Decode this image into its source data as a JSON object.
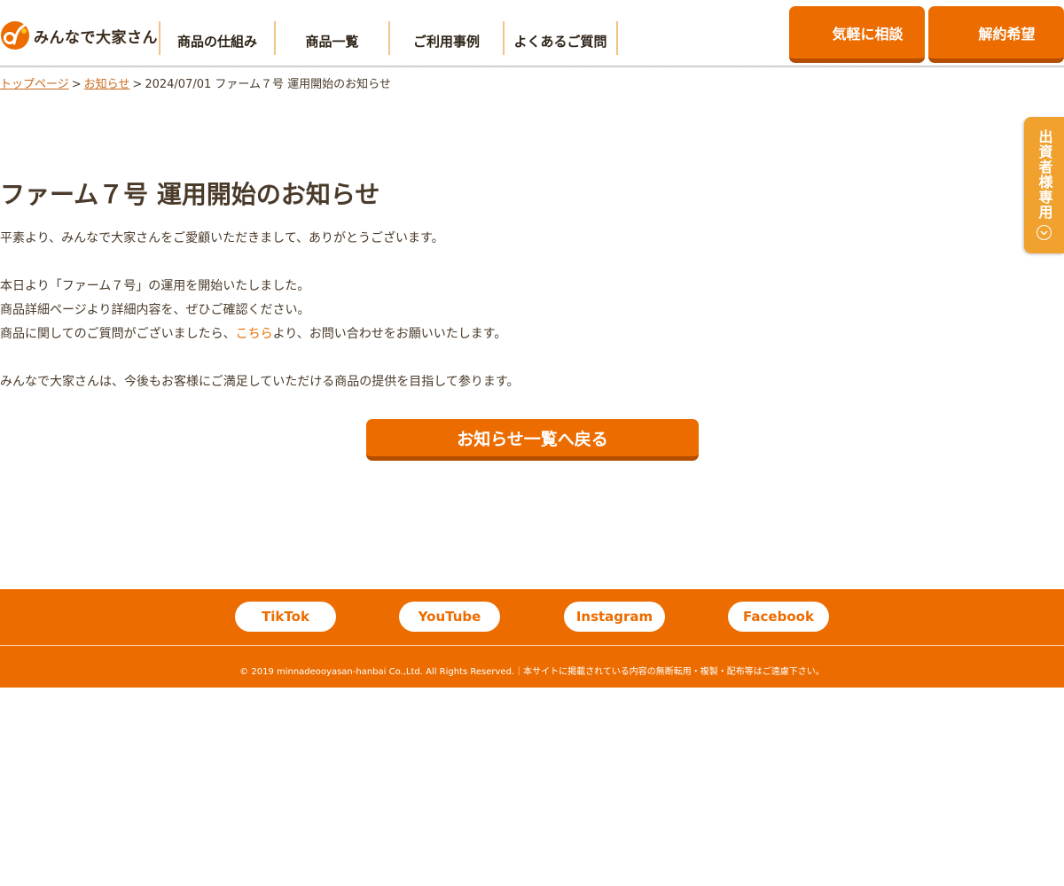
{
  "header": {
    "logo_text": "みんなで大家さん",
    "nav": [
      {
        "label": "商品の仕組み"
      },
      {
        "label": "商品一覧"
      },
      {
        "label": "ご利用事例"
      },
      {
        "label": "よくあるご質問"
      }
    ],
    "cta": [
      {
        "label": "気軽に相談"
      },
      {
        "label": "解約希望"
      }
    ]
  },
  "breadcrumb": {
    "items": [
      "トップページ",
      "お知らせ"
    ],
    "separator": ">",
    "current": "2024/07/01 ファーム７号 運用開始のお知らせ"
  },
  "side_tab": {
    "label": "出資者様専用",
    "icon": "chevron-down-circle-icon"
  },
  "article": {
    "title": "ファーム７号 運用開始のお知らせ",
    "para1": "平素より、みんなで大家さんをご愛顧いただきまして、ありがとうございます。",
    "para2_line1": "本日より「ファーム７号」の運用を開始いたしました。",
    "para2_line2": "商品詳細ページより詳細内容を、ぜひご確認ください。",
    "para2_line3_before": "商品に関してのご質問がございましたら、",
    "para2_line3_link": "こちら",
    "para2_line3_after": "より、お問い合わせをお願いいたします。",
    "para3": "みんなで大家さんは、今後もお客様にご満足していただける商品の提供を目指して参ります。"
  },
  "back_button": {
    "label": "お知らせ一覧へ戻る"
  },
  "footer": {
    "social": [
      {
        "label": "TikTok"
      },
      {
        "label": "YouTube"
      },
      {
        "label": "Instagram"
      },
      {
        "label": "Facebook"
      }
    ],
    "copyright": "© 2019 minnadeooyasan-hanbai Co.,Ltd. All Rights Reserved.｜本サイトに掲載されている内容の無断転用・複製・配布等はご遠慮下さい。"
  },
  "colors": {
    "brand_orange": "#ec6c00",
    "side_tab_orange": "#f0a12e",
    "text_brown": "#4a3a2a",
    "link_orange": "#c96a1c"
  }
}
